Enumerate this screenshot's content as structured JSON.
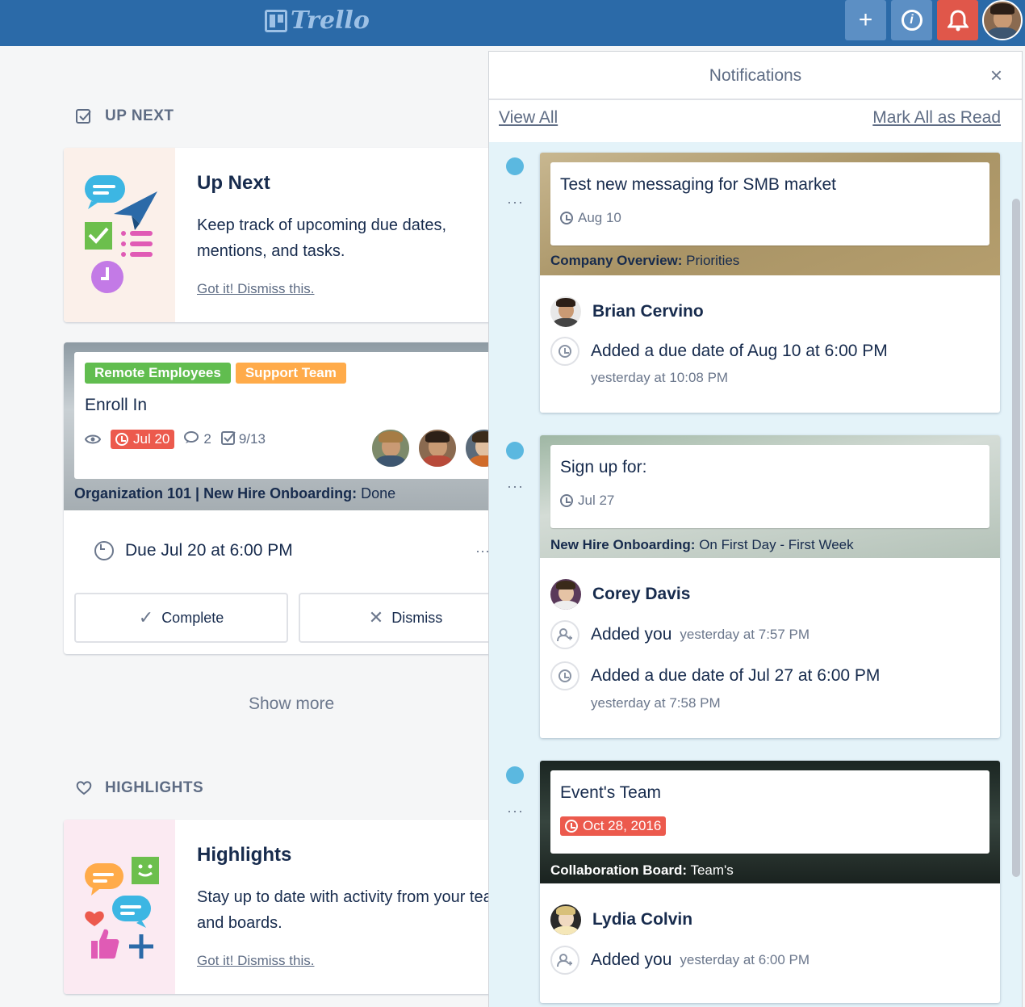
{
  "topbar": {
    "logo": "Trello",
    "add_icon": "+",
    "info_icon": "i",
    "bell_icon": "bell"
  },
  "left": {
    "up_next_heading": "UP NEXT",
    "up_next_card": {
      "title": "Up Next",
      "text": "Keep track of upcoming due dates, mentions, and tasks.",
      "dismiss": "Got it! Dismiss this."
    },
    "task_card": {
      "labels": [
        {
          "text": "Remote Employees",
          "color": "#61bd4f"
        },
        {
          "text": "Support Team",
          "color": "#ffab4a"
        }
      ],
      "title": "Enroll In",
      "due_badge": "Jul 20",
      "comments": "2",
      "checklist": "9/13",
      "board_bold": "Organization 101 | New Hire Onboarding:",
      "board_list": " Done",
      "due_text": "Due Jul 20 at 6:00 PM",
      "complete_label": "Complete",
      "dismiss_label": "Dismiss"
    },
    "show_more": "Show more",
    "highlights_heading": "HIGHLIGHTS",
    "highlights_card": {
      "title": "Highlights",
      "text": "Stay up to date with activity from your teams and boards.",
      "dismiss": "Got it! Dismiss this."
    }
  },
  "notifications": {
    "title": "Notifications",
    "close": "×",
    "view_all": "View All",
    "mark_all": "Mark All as Read",
    "items": [
      {
        "card_title": "Test new messaging for SMB market",
        "due": "Aug 10",
        "board_bold": "Company Overview:",
        "board_list": " Priorities",
        "person": "Brian Cervino",
        "act1": "Added a due date of Aug 10 at 6:00 PM",
        "act1_when": "yesterday at 10:08 PM"
      },
      {
        "card_title": "Sign up for:",
        "due": "Jul 27",
        "board_bold": "New Hire Onboarding:",
        "board_list": " On First Day - First Week",
        "person": "Corey Davis",
        "act1": "Added you",
        "act1_when": "yesterday at 7:57 PM",
        "act2": "Added a due date of Jul 27 at 6:00 PM",
        "act2_when": "yesterday at 7:58 PM"
      },
      {
        "card_title": "Event's Team",
        "due": "Oct 28, 2016",
        "board_bold": "Collaboration Board:",
        "board_list": " Team's",
        "person": "Lydia Colvin",
        "act1": "Added you",
        "act1_when": "yesterday at 6:00 PM"
      }
    ]
  }
}
